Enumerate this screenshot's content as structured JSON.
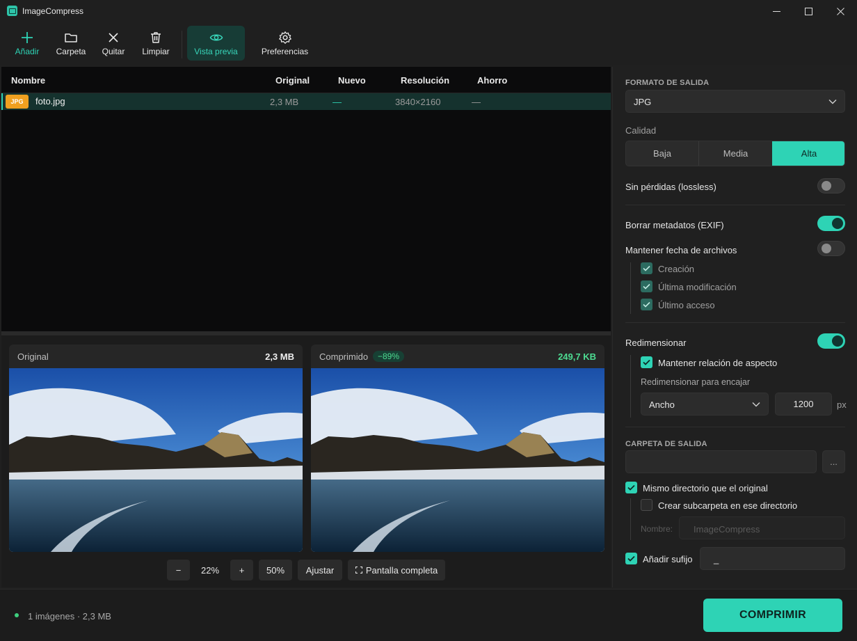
{
  "window": {
    "title": "ImageCompress",
    "controls": [
      "minimize",
      "maximize",
      "close"
    ]
  },
  "toolbar": {
    "add": "Añadir",
    "folder": "Carpeta",
    "remove": "Quitar",
    "clear": "Limpiar",
    "preview": "Vista previa",
    "preferences": "Preferencias"
  },
  "table": {
    "headers": {
      "name": "Nombre",
      "original": "Original",
      "new": "Nuevo",
      "resolution": "Resolución",
      "savings": "Ahorro"
    },
    "rows": [
      {
        "badge": "JPG",
        "name": "foto.jpg",
        "original": "2,3 MB",
        "new": "—",
        "resolution": "3840×2160",
        "savings": "—",
        "selected": true
      }
    ]
  },
  "preview": {
    "original": {
      "label": "Original",
      "size": "2,3 MB"
    },
    "compressed": {
      "label": "Comprimido",
      "reduction": "−89%",
      "size": "249,7 KB"
    },
    "zoom": {
      "minus": "−",
      "value": "22%",
      "plus": "+",
      "preset": "50%",
      "fit": "Ajustar",
      "fullscreen": "Pantalla completa"
    }
  },
  "panel": {
    "output_format_title": "FORMATO DE SALIDA",
    "format": "JPG",
    "quality_label": "Calidad",
    "quality_options": [
      "Baja",
      "Media",
      "Alta"
    ],
    "quality_selected": "Alta",
    "lossless_label": "Sin pérdidas (lossless)",
    "lossless": false,
    "strip_metadata_label": "Borrar metadatos (EXIF)",
    "strip_metadata": true,
    "keep_dates_label": "Mantener fecha de archivos",
    "keep_dates": false,
    "date_options": [
      {
        "label": "Creación",
        "checked": true
      },
      {
        "label": "Última modificación",
        "checked": true
      },
      {
        "label": "Último acceso",
        "checked": true
      }
    ],
    "resize_label": "Redimensionar",
    "resize": true,
    "keep_aspect_label": "Mantener relación de aspecto",
    "keep_aspect": true,
    "fit_label": "Redimensionar para encajar",
    "fit_dimension": "Ancho",
    "fit_value": "1200",
    "fit_unit": "px",
    "output_folder_title": "CARPETA DE SALIDA",
    "browse": "...",
    "same_dir_label": "Mismo directorio que el original",
    "same_dir": true,
    "subfolder_label": "Crear subcarpeta en ese directorio",
    "subfolder": false,
    "subfolder_name_label": "Nombre:",
    "subfolder_name_placeholder": "ImageCompress",
    "suffix_label": "Añadir sufijo",
    "suffix": true,
    "suffix_value": "_"
  },
  "footer": {
    "status": "1 imágenes · 2,3 MB",
    "compress": "COMPRIMIR"
  },
  "colors": {
    "accent": "#2ED3B5",
    "success": "#4DDC92",
    "badge_jpg": "#F0A020"
  }
}
